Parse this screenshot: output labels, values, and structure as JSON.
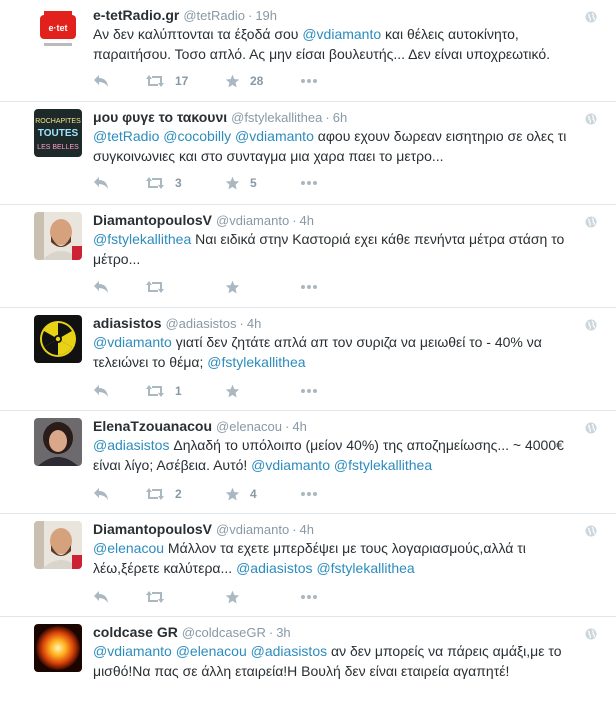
{
  "tweets": [
    {
      "fullname": "e-tetRadio.gr",
      "screenname": "@tetRadio",
      "dot": "·",
      "time": "19h",
      "avatar": "etet-radio-logo",
      "text": [
        {
          "t": "Αν δεν καλύπτονται τα έξοδά σου "
        },
        {
          "t": "@vdiamanto",
          "m": true
        },
        {
          "t": " και θέλεις αυτοκίνητο, παραιτήσου. Τοσο απλό. Ας μην είσαι βουλευτής... Δεν είναι υποχρεωτικό."
        }
      ],
      "retweets": "17",
      "favorites": "28"
    },
    {
      "fullname": "μου φυγε το τακουνι",
      "screenname": "@fstylekallithea",
      "dot": "·",
      "time": "6h",
      "avatar": "chalkboard-avatar",
      "avatar_text": [
        "ROCHAPITES",
        "TOUTES",
        "LES BELLES"
      ],
      "text": [
        {
          "t": "@tetRadio",
          "m": true
        },
        {
          "t": " "
        },
        {
          "t": "@cocobilly",
          "m": true
        },
        {
          "t": " "
        },
        {
          "t": "@vdiamanto",
          "m": true
        },
        {
          "t": " αφου εχουν δωρεαν εισητηριο σε ολες τι συγκοινωνιες και στο συνταγμα μια χαρα παει το μετρο..."
        }
      ],
      "retweets": "3",
      "favorites": "5"
    },
    {
      "fullname": "DiamantopoulosV",
      "screenname": "@vdiamanto",
      "dot": "·",
      "time": "4h",
      "avatar": "bald-man-avatar",
      "text": [
        {
          "t": "@fstylekallithea",
          "m": true
        },
        {
          "t": " Ναι ειδικά στην Καστοριά εχει κάθε πενήντα μέτρα στάση το μέτρο..."
        }
      ],
      "retweets": "",
      "favorites": ""
    },
    {
      "fullname": "adiasistos",
      "screenname": "@adiasistos",
      "dot": "·",
      "time": "4h",
      "avatar": "radiation-symbol-avatar",
      "text": [
        {
          "t": "@vdiamanto",
          "m": true
        },
        {
          "t": " γιατί δεν ζητάτε απλά απ τον συριζα να μειωθεί το - 40% να τελειώνει το θέμα; "
        },
        {
          "t": "@fstylekallithea",
          "m": true
        }
      ],
      "retweets": "1",
      "favorites": ""
    },
    {
      "fullname": "ElenaTzouanacou",
      "screenname": "@elenacou",
      "dot": "·",
      "time": "4h",
      "avatar": "woman-avatar",
      "text": [
        {
          "t": "@adiasistos",
          "m": true
        },
        {
          "t": " Δηλαδή το υπόλοιπο (μείον 40%) της αποζημείωσης... ~ 4000€ είναι λίγο; Ασέβεια. Αυτό! "
        },
        {
          "t": "@vdiamanto",
          "m": true
        },
        {
          "t": " "
        },
        {
          "t": "@fstylekallithea",
          "m": true
        }
      ],
      "retweets": "2",
      "favorites": "4"
    },
    {
      "fullname": "DiamantopoulosV",
      "screenname": "@vdiamanto",
      "dot": "·",
      "time": "4h",
      "avatar": "bald-man-avatar",
      "text": [
        {
          "t": "@elenacou",
          "m": true
        },
        {
          "t": " Μάλλον τα εχετε μπερδέψει με τους λογαριασμούς,αλλά τι λέω,ξέρετε καλύτερα... "
        },
        {
          "t": "@adiasistos",
          "m": true
        },
        {
          "t": " "
        },
        {
          "t": "@fstylekallithea",
          "m": true
        }
      ],
      "retweets": "",
      "favorites": ""
    },
    {
      "fullname": "coldcase GR",
      "screenname": "@coldcaseGR",
      "dot": "·",
      "time": "3h",
      "avatar": "fire-sphere-avatar",
      "text": [
        {
          "t": "@vdiamanto",
          "m": true
        },
        {
          "t": " "
        },
        {
          "t": "@elenacou",
          "m": true
        },
        {
          "t": " "
        },
        {
          "t": "@adiasistos",
          "m": true
        },
        {
          "t": " αν δεν μπορείς να πάρεις αμάξι,με το μισθό!Να πας σε άλλη εταιρεία!Η Βουλή δεν είναι εταιρεία αγαπητέ!"
        }
      ],
      "retweets": "",
      "favorites": ""
    }
  ],
  "colors": {
    "mention": "#2b8cbd",
    "meta": "#8899a6",
    "text": "#292f33",
    "divider": "#e1e8ed"
  },
  "icons": [
    "reply-icon",
    "retweet-icon",
    "favorite-icon",
    "more-icon",
    "globe-icon"
  ]
}
